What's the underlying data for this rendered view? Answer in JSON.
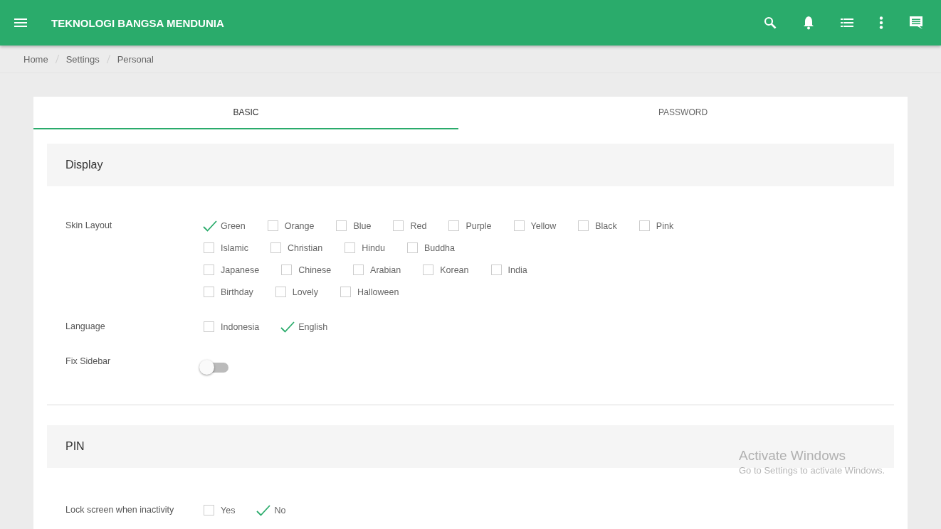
{
  "app_bar": {
    "title": "TEKNOLOGI BANGSA MENDUNIA"
  },
  "breadcrumb": [
    "Home",
    "Settings",
    "Personal"
  ],
  "tabs": [
    {
      "label": "BASIC",
      "selected": true
    },
    {
      "label": "PASSWORD",
      "selected": false
    }
  ],
  "sections": [
    {
      "title": "Display",
      "fields": [
        {
          "label": "Skin Layout",
          "kind": "checkboxes",
          "option_rows": [
            [
              {
                "label": "Green",
                "checked": true
              },
              {
                "label": "Orange",
                "checked": false
              },
              {
                "label": "Blue",
                "checked": false
              },
              {
                "label": "Red",
                "checked": false
              },
              {
                "label": "Purple",
                "checked": false
              },
              {
                "label": "Yellow",
                "checked": false
              },
              {
                "label": "Black",
                "checked": false
              },
              {
                "label": "Pink",
                "checked": false
              }
            ],
            [
              {
                "label": "Islamic",
                "checked": false
              },
              {
                "label": "Christian",
                "checked": false
              },
              {
                "label": "Hindu",
                "checked": false
              },
              {
                "label": "Buddha",
                "checked": false
              }
            ],
            [
              {
                "label": "Japanese",
                "checked": false
              },
              {
                "label": "Chinese",
                "checked": false
              },
              {
                "label": "Arabian",
                "checked": false
              },
              {
                "label": "Korean",
                "checked": false
              },
              {
                "label": "India",
                "checked": false
              }
            ],
            [
              {
                "label": "Birthday",
                "checked": false
              },
              {
                "label": "Lovely",
                "checked": false
              },
              {
                "label": "Halloween",
                "checked": false
              }
            ]
          ]
        },
        {
          "label": "Language",
          "kind": "checkboxes",
          "option_rows": [
            [
              {
                "label": "Indonesia",
                "checked": false
              },
              {
                "label": "English",
                "checked": true
              }
            ]
          ]
        },
        {
          "label": "Fix Sidebar",
          "kind": "switch",
          "on": false
        }
      ]
    },
    {
      "title": "PIN",
      "fields": [
        {
          "label": "Lock screen when inactivity",
          "kind": "checkboxes",
          "option_rows": [
            [
              {
                "label": "Yes",
                "checked": false
              },
              {
                "label": "No",
                "checked": true
              }
            ]
          ]
        }
      ]
    }
  ],
  "os_notice": {
    "title": "Activate Windows",
    "text": "Go to Settings to activate Windows."
  }
}
